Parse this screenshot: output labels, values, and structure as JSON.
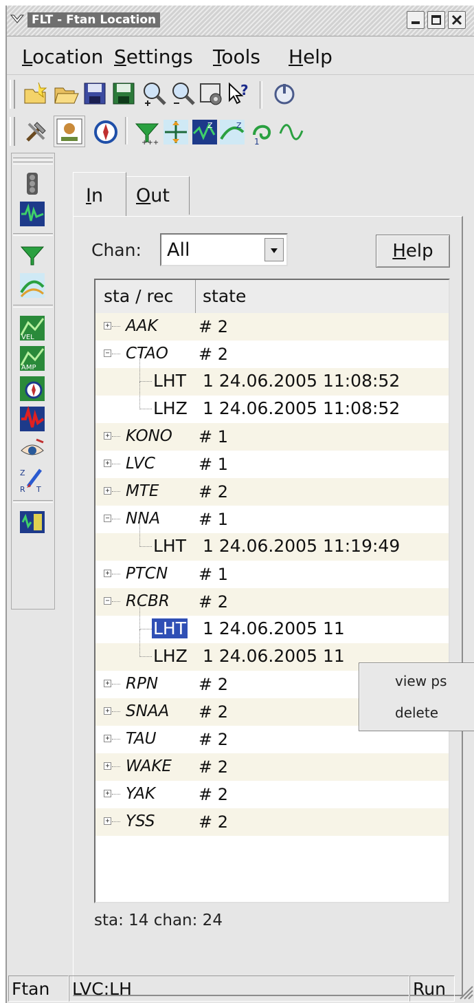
{
  "window": {
    "title": "FLT - Ftan Location",
    "buttons": [
      "minimize-icon",
      "maximize-icon",
      "close-icon"
    ]
  },
  "menubar": {
    "items": [
      {
        "label": "Location",
        "mn": "L",
        "rest": "ocation"
      },
      {
        "label": "Settings",
        "mn": "S",
        "rest": "ettings"
      },
      {
        "label": "Tools",
        "mn": "T",
        "rest": "ools"
      },
      {
        "label": "Help",
        "mn": "H",
        "rest": "elp"
      }
    ]
  },
  "toolbar1": [
    "new-folder-icon",
    "open-icon",
    "save-icon",
    "save-as-icon",
    "zoom-in-icon",
    "zoom-out-icon",
    "view-settings-icon",
    "whats-this-icon",
    "power-icon"
  ],
  "toolbar2": [
    "tools-icon",
    "station-map-icon",
    "compass-icon",
    "filter-icon",
    "cross-arrows-icon",
    "rotate-zrt-icon",
    "rotate-zrt-2-icon",
    "wave-one-icon",
    "sine-wave-icon"
  ],
  "vtoolbar": [
    "traffic-light-icon",
    "seismogram-icon",
    "filter-icon",
    "curve-icon",
    "velocity-icon",
    "amplitude-icon",
    "compass-icon",
    "red-seismogram-icon",
    "eye-icon",
    "zrt-pen-icon",
    "book-icon"
  ],
  "tabs": [
    {
      "label": "In",
      "mn": "I",
      "rest": "n"
    },
    {
      "label": "Out",
      "mn": "O",
      "rest": "ut"
    }
  ],
  "panel": {
    "chan_label": "Chan:",
    "chan_value": "All",
    "help": {
      "label": "Help",
      "mn": "H",
      "rest": "elp"
    },
    "columns": [
      "sta / rec",
      "state"
    ],
    "summary": "sta: 14 chan: 24"
  },
  "rows": [
    {
      "kind": "sta",
      "sta": "AAK",
      "state": "# 2",
      "expanded": false
    },
    {
      "kind": "sta",
      "sta": "CTAO",
      "state": "# 2",
      "expanded": true
    },
    {
      "kind": "chan",
      "chan": "LHT",
      "state": "1 24.06.2005 11:08:52"
    },
    {
      "kind": "chan",
      "chan": "LHZ",
      "state": "1 24.06.2005 11:08:52"
    },
    {
      "kind": "sta",
      "sta": "KONO",
      "state": "# 1",
      "expanded": false
    },
    {
      "kind": "sta",
      "sta": "LVC",
      "state": "# 1",
      "expanded": false
    },
    {
      "kind": "sta",
      "sta": "MTE",
      "state": "# 2",
      "expanded": false
    },
    {
      "kind": "sta",
      "sta": "NNA",
      "state": "# 1",
      "expanded": true
    },
    {
      "kind": "chan",
      "chan": "LHT",
      "state": "1 24.06.2005 11:19:49"
    },
    {
      "kind": "sta",
      "sta": "PTCN",
      "state": "# 1",
      "expanded": false
    },
    {
      "kind": "sta",
      "sta": "RCBR",
      "state": "# 2",
      "expanded": true
    },
    {
      "kind": "chan",
      "chan": "LHT",
      "state": "1 24.06.2005 11",
      "selected": true
    },
    {
      "kind": "chan",
      "chan": "LHZ",
      "state": "1 24.06.2005 11"
    },
    {
      "kind": "sta",
      "sta": "RPN",
      "state": "# 2",
      "expanded": false
    },
    {
      "kind": "sta",
      "sta": "SNAA",
      "state": "# 2",
      "expanded": false
    },
    {
      "kind": "sta",
      "sta": "TAU",
      "state": "# 2",
      "expanded": false
    },
    {
      "kind": "sta",
      "sta": "WAKE",
      "state": "# 2",
      "expanded": false
    },
    {
      "kind": "sta",
      "sta": "YAK",
      "state": "# 2",
      "expanded": false
    },
    {
      "kind": "sta",
      "sta": "YSS",
      "state": "# 2",
      "expanded": false
    }
  ],
  "context_menu": [
    "view ps",
    "delete"
  ],
  "statusbar": [
    "Ftan",
    "LVC:LH",
    "Run"
  ]
}
